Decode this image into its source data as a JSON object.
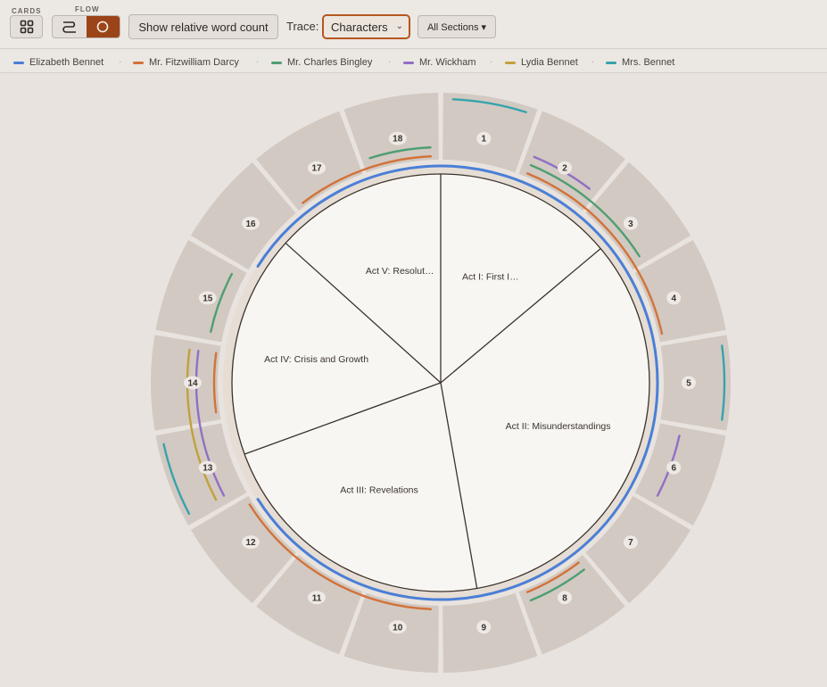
{
  "toolbar": {
    "cards_label": "CARDS",
    "flow_label": "FLOW",
    "word_count_button": "Show relative word count",
    "trace_label": "Trace:",
    "trace_value": "Characters",
    "sections_button": "All Sections ▾"
  },
  "legend": [
    {
      "name": "Elizabeth Bennet",
      "color": "#4a7fd6"
    },
    {
      "name": "Mr. Fitzwilliam Darcy",
      "color": "#d2733a"
    },
    {
      "name": "Mr. Charles Bingley",
      "color": "#4f9e73"
    },
    {
      "name": "Mr. Wickham",
      "color": "#9070c4"
    },
    {
      "name": "Lydia Bennet",
      "color": "#c2a03c"
    },
    {
      "name": "Mrs. Bennet",
      "color": "#36a3ad"
    }
  ],
  "acts": [
    {
      "label": "Act I: First I…"
    },
    {
      "label": "Act II: Misunderstandings"
    },
    {
      "label": "Act III: Revelations"
    },
    {
      "label": "Act IV: Crisis and Growth"
    },
    {
      "label": "Act V: Resolut…"
    }
  ],
  "scenes": [
    "1",
    "2",
    "3",
    "4",
    "5",
    "6",
    "7",
    "8",
    "9",
    "10",
    "11",
    "12",
    "13",
    "14",
    "15",
    "16",
    "17",
    "18"
  ],
  "traces": [
    {
      "character": "Elizabeth Bennet",
      "scenes": [
        1,
        2,
        3,
        4,
        5,
        6,
        7,
        8,
        9,
        10,
        11,
        12,
        16,
        17,
        18
      ],
      "lane": 0
    },
    {
      "character": "Mr. Fitzwilliam Darcy",
      "scenes": [
        2,
        3,
        4,
        8,
        10,
        11,
        12,
        14,
        17,
        18
      ],
      "lane": 1
    },
    {
      "character": "Mr. Charles Bingley",
      "scenes": [
        2,
        3,
        8,
        15,
        18
      ],
      "lane": 2
    },
    {
      "character": "Mr. Wickham",
      "scenes": [
        2,
        6,
        13,
        14
      ],
      "lane": 3
    },
    {
      "character": "Lydia Bennet",
      "scenes": [
        13,
        14
      ],
      "lane": 4
    },
    {
      "character": "Mrs. Bennet",
      "scenes": [
        1,
        5,
        13
      ],
      "lane": 5
    }
  ]
}
